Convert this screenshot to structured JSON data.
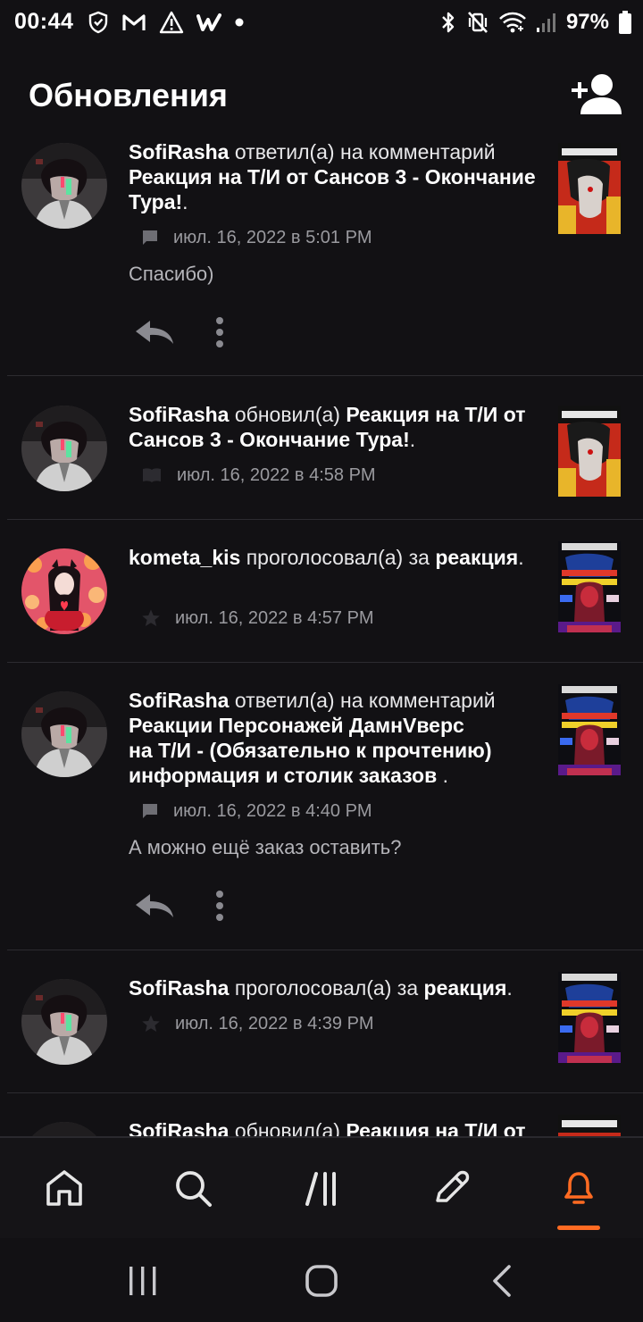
{
  "status_bar": {
    "time": "00:44",
    "battery": "97%"
  },
  "header": {
    "title": "Обновления"
  },
  "colors": {
    "accent": "#ff6b22",
    "background": "#121114"
  },
  "feed": [
    {
      "user": "SofiRasha",
      "action": "ответил(а) на комментарий",
      "story": "Реакция на Т/И от Сансов 3 - Окончание Тура!",
      "timestamp": "июл. 16, 2022 в 5:01 PM",
      "type_icon": "comment-icon",
      "comment": "Спасибо)"
    },
    {
      "user": "SofiRasha",
      "action": "обновил(а)",
      "story": "Реакция на Т/И от Сансов 3 - Окончание Тура!",
      "timestamp": "июл. 16, 2022 в 4:58 PM",
      "type_icon": "book-icon"
    },
    {
      "user": "kometa_kis",
      "action": "проголосовал(а) за",
      "story": "реакция",
      "timestamp": "июл. 16, 2022 в 4:57 PM",
      "type_icon": "star-icon"
    },
    {
      "user": "SofiRasha",
      "action": "ответил(а) на комментарий",
      "story_lines": [
        "Реакции Персонажей ДамнVверс",
        "на Т/И - (Обязательно к прочтению)",
        "информация и столик заказов"
      ],
      "timestamp": "июл. 16, 2022 в 4:40 PM",
      "type_icon": "comment-icon",
      "comment": "А можно ещё заказ оставить?"
    },
    {
      "user": "SofiRasha",
      "action": "проголосовал(а) за",
      "story": "реакция",
      "timestamp": "июл. 16, 2022 в 4:39 PM",
      "type_icon": "star-icon"
    },
    {
      "user": "SofiRasha",
      "action": "обновил(а)",
      "story": "Реакция на Т/И от",
      "type_icon": "book-icon"
    }
  ],
  "bottom_nav": {
    "items": [
      "home-icon",
      "search-icon",
      "library-icon",
      "write-icon",
      "notifications-icon"
    ],
    "active": "notifications-icon"
  }
}
